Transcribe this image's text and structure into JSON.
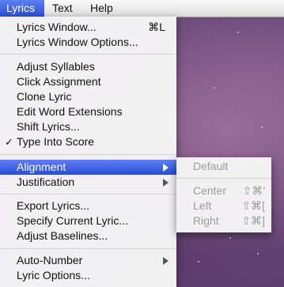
{
  "menubar": {
    "items": [
      {
        "label": "Lyrics"
      },
      {
        "label": "Text"
      },
      {
        "label": "Help"
      }
    ]
  },
  "lyrics_menu": {
    "items": [
      {
        "label": "Lyrics Window...",
        "shortcut": "⌘L"
      },
      {
        "label": "Lyrics Window Options..."
      },
      {
        "label": "Adjust Syllables"
      },
      {
        "label": "Click Assignment"
      },
      {
        "label": "Clone Lyric"
      },
      {
        "label": "Edit Word Extensions"
      },
      {
        "label": "Shift Lyrics..."
      },
      {
        "label": "Type Into Score",
        "check": "✓"
      },
      {
        "label": "Alignment"
      },
      {
        "label": "Justification"
      },
      {
        "label": "Export Lyrics..."
      },
      {
        "label": "Specify Current Lyric..."
      },
      {
        "label": "Adjust Baselines..."
      },
      {
        "label": "Auto-Number"
      },
      {
        "label": "Lyric Options..."
      }
    ]
  },
  "alignment_submenu": {
    "items": [
      {
        "label": "Default"
      },
      {
        "label": "Center",
        "shortcut": "⇧⌘'"
      },
      {
        "label": "Left",
        "shortcut": "⇧⌘["
      },
      {
        "label": "Right",
        "shortcut": "⇧⌘]"
      }
    ]
  }
}
